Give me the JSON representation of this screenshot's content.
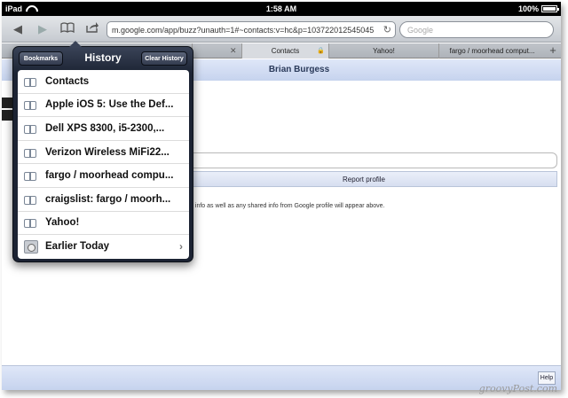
{
  "status_bar": {
    "device": "iPad",
    "time": "1:58 AM",
    "battery": "100%"
  },
  "toolbar": {
    "url": "m.google.com/app/buzz?unauth=1#~contacts:v=hc&p=103722012545045",
    "search_placeholder": "Google"
  },
  "tabs": [
    {
      "label": ""
    },
    {
      "label": "Contacts"
    },
    {
      "label": "Yahoo!"
    },
    {
      "label": "fargo / moorhead comput..."
    }
  ],
  "page": {
    "header_title": "Brian Burgess",
    "report_button": "Report profile",
    "info_text": "t info as well as any shared info from Google profile will appear above.",
    "help_button": "Help"
  },
  "popover": {
    "bookmarks_button": "Bookmarks",
    "title": "History",
    "clear_button": "Clear History",
    "items": [
      {
        "label": "Contacts",
        "icon": "book-icon"
      },
      {
        "label": "Apple iOS 5: Use the Def...",
        "icon": "book-icon"
      },
      {
        "label": "Dell XPS 8300, i5-2300,...",
        "icon": "book-icon"
      },
      {
        "label": "Verizon Wireless MiFi22...",
        "icon": "book-icon"
      },
      {
        "label": "fargo / moorhead compu...",
        "icon": "book-icon"
      },
      {
        "label": "craigslist: fargo / moorh...",
        "icon": "book-icon"
      },
      {
        "label": "Yahoo!",
        "icon": "book-icon"
      },
      {
        "label": "Earlier Today",
        "icon": "clock-icon"
      }
    ]
  },
  "watermark": "groovyPost.com"
}
